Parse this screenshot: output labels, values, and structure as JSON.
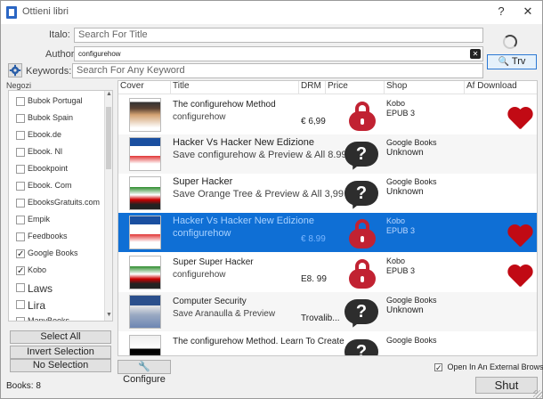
{
  "window": {
    "title": "Ottieni libri"
  },
  "titlebar_buttons": {
    "help": "?",
    "close": "✕"
  },
  "form": {
    "title_label": "Italo:",
    "title_placeholder": "Search For Title",
    "author_label": "Author:",
    "author_value": "configurehow",
    "keywords_label": "Keywords:",
    "keywords_placeholder": "Search For Any Keyword"
  },
  "buttons": {
    "search": "Trv",
    "select_all": "Select All",
    "invert_selection": "Invert Selection",
    "no_selection": "No Selection",
    "configure": "Configure",
    "shut": "Shut"
  },
  "stores": {
    "label": "Negozi",
    "items": [
      {
        "name": "Bubok Portugal",
        "checked": false
      },
      {
        "name": "Bubok Spain",
        "checked": false
      },
      {
        "name": "Ebook.de",
        "checked": false
      },
      {
        "name": "Ebook. Nl",
        "checked": false
      },
      {
        "name": "Ebookpoint",
        "checked": false
      },
      {
        "name": "Ebook. Com",
        "checked": false
      },
      {
        "name": "EbooksGratuits.com",
        "checked": false
      },
      {
        "name": "Empik",
        "checked": false
      },
      {
        "name": "Feedbooks",
        "checked": false
      },
      {
        "name": "Google Books",
        "checked": true
      },
      {
        "name": "Kobo",
        "checked": true
      },
      {
        "name": "Laws",
        "checked": false
      },
      {
        "name": "Lira",
        "checked": false
      },
      {
        "name": "ManyBooks",
        "checked": false
      }
    ]
  },
  "results": {
    "columns": [
      "Cover",
      "Title",
      "DRM",
      "Price",
      "Shop",
      "Af Download"
    ],
    "rows": [
      {
        "cover": "face",
        "title": "The configurehow Method",
        "author": "configurehow",
        "price": "€ 6,99",
        "drm": "locked",
        "shop": "Kobo",
        "format": "EPUB 3",
        "download": true,
        "style": "normal"
      },
      {
        "cover": "hacker",
        "title": "Hacker Vs Hacker New Edizione",
        "author": "Save configurehow & Preview & All 8.99 €",
        "price": "",
        "drm": "unknown",
        "shop": "Google Books",
        "format": "Unknown",
        "download": false,
        "style": "alt-big"
      },
      {
        "cover": "super",
        "title": "Super Hacker",
        "author": "Save Orange Tree & Preview & All 3,99 €",
        "price": "",
        "drm": "unknown",
        "shop": "Google Books",
        "format": "Unknown",
        "download": false,
        "style": "big"
      },
      {
        "cover": "hacker",
        "title": "Hacker Vs Hacker New Edizione",
        "author": "configurehow",
        "price": "€ 8.99",
        "drm": "locked",
        "shop": "Kobo",
        "format": "EPUB 3",
        "download": true,
        "style": "selected"
      },
      {
        "cover": "super",
        "title": "Super Super Hacker",
        "author": "configurehow",
        "price": "E8. 99",
        "drm": "locked",
        "shop": "Kobo",
        "format": "EPUB 3",
        "download": true,
        "style": "normal"
      },
      {
        "cover": "security",
        "title": "Computer Security",
        "author": "Save Aranaulla & Preview",
        "price": "Trovalib...",
        "drm": "unknown",
        "shop": "Google Books",
        "format": "Unknown",
        "download": false,
        "style": "alt"
      },
      {
        "cover": "book",
        "title": "The configurehow Method. Learn To Create",
        "author": "",
        "price": "",
        "drm": "unknown",
        "shop": "Google Books",
        "format": "",
        "download": false,
        "style": "normal"
      }
    ]
  },
  "open_external": {
    "label": "Open In An External Browser",
    "checked": true
  },
  "status": {
    "books": "Books: 8"
  }
}
